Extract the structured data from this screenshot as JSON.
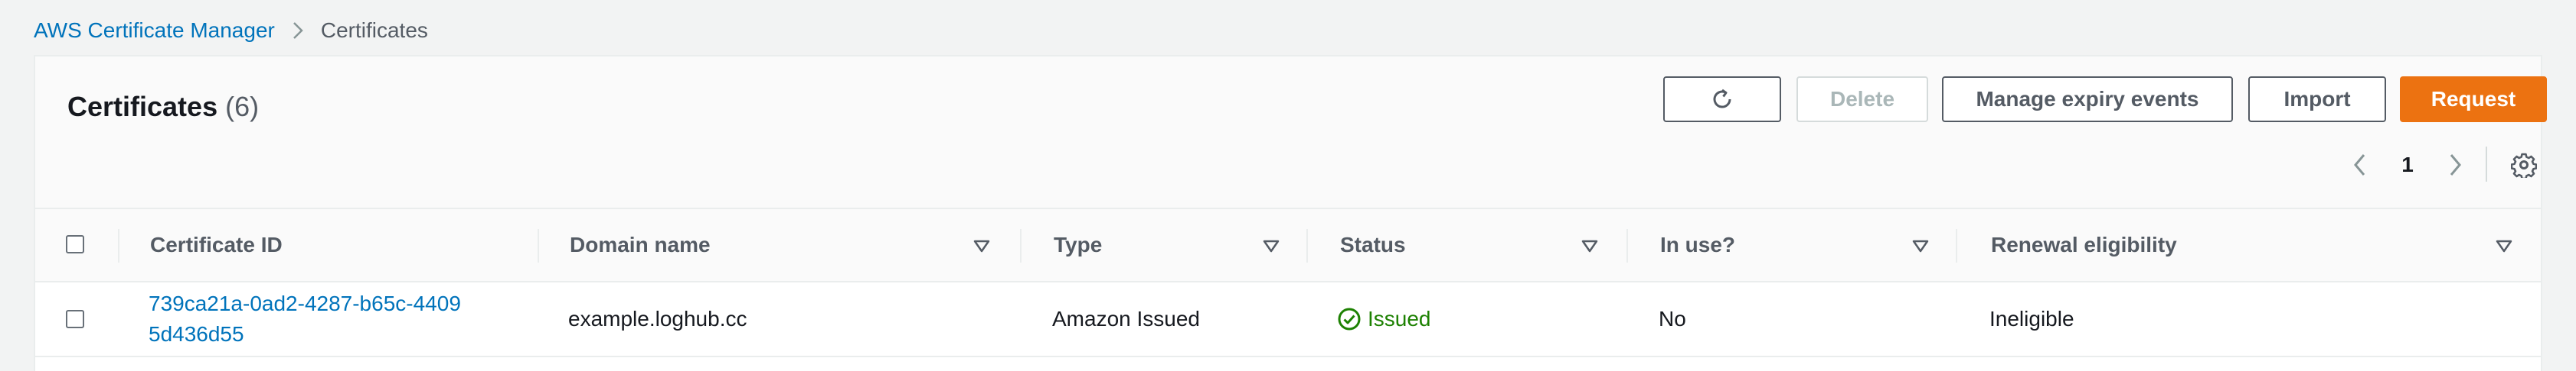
{
  "breadcrumb": {
    "parent": "AWS Certificate Manager",
    "current": "Certificates"
  },
  "header": {
    "title": "Certificates",
    "count": "(6)"
  },
  "toolbar": {
    "refresh_icon": "refresh-icon",
    "delete_label": "Delete",
    "expiry_label": "Manage expiry events",
    "import_label": "Import",
    "request_label": "Request"
  },
  "pagination": {
    "current_page": "1",
    "prev_icon": "chevron-left-icon",
    "next_icon": "chevron-right-icon",
    "settings_icon": "gear-icon"
  },
  "table": {
    "columns": [
      "Certificate ID",
      "Domain name",
      "Type",
      "Status",
      "In use?",
      "Renewal eligibility"
    ],
    "rows": [
      {
        "certificate_id": "739ca21a-0ad2-4287-b65c-44095d436d55",
        "domain_name": "example.loghub.cc",
        "type": "Amazon Issued",
        "status": "Issued",
        "in_use": "No",
        "renewal_eligibility": "Ineligible"
      }
    ]
  },
  "colors": {
    "link": "#0073bb",
    "primary_button": "#ec7211",
    "success": "#1d8102",
    "background": "#f2f3f3"
  }
}
